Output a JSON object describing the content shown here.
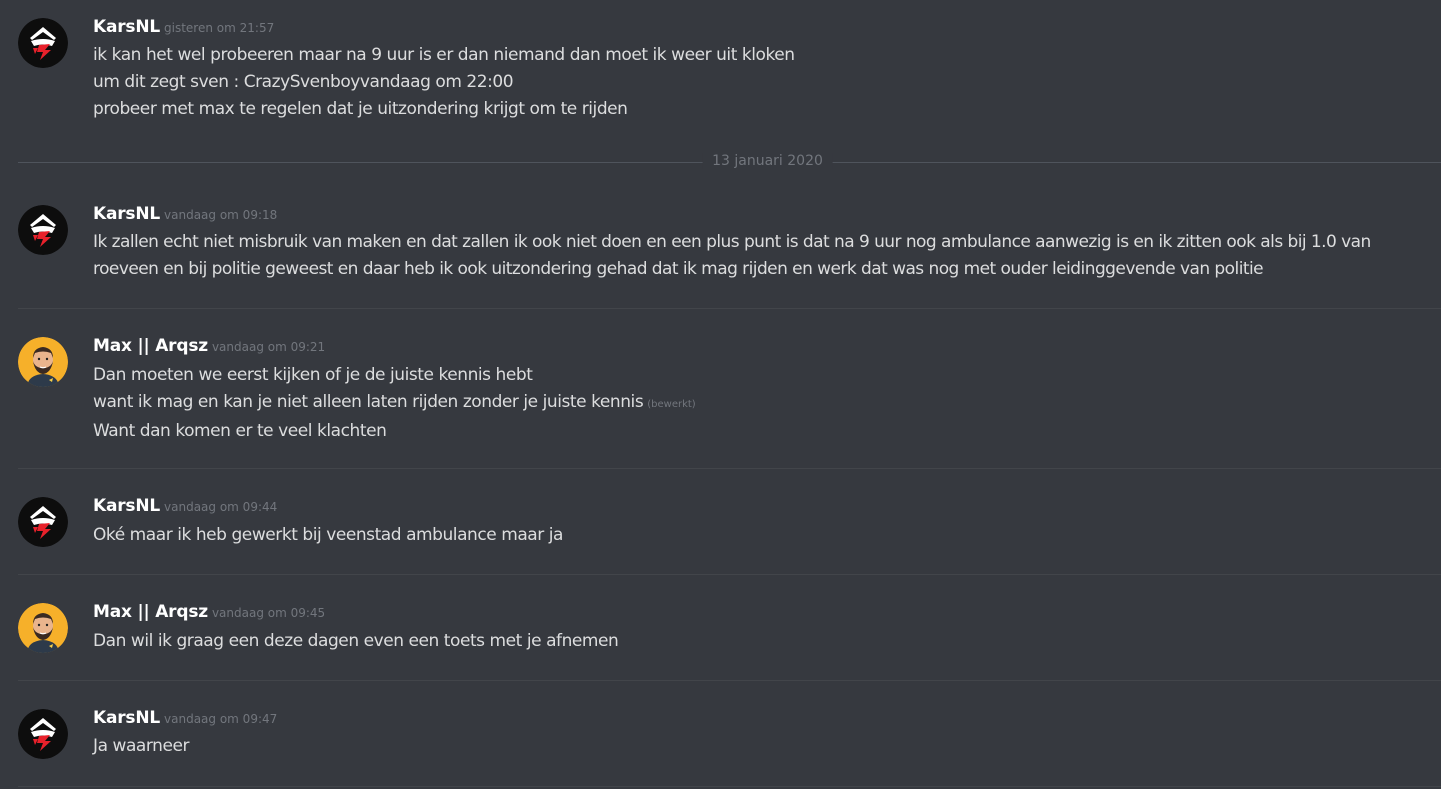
{
  "date_divider": "13 januari 2020",
  "messages": [
    {
      "author": "KarsNL",
      "timestamp": "gisteren om 21:57",
      "avatar_icon": "ninja-logo-icon",
      "lines": [
        "ik kan het wel probeeren maar na 9 uur is er dan niemand dan moet ik weer uit kloken",
        "um dit zegt sven : CrazySvenboyvandaag om 22:00",
        "probeer met max te regelen dat je uitzondering krijgt om te rijden"
      ]
    },
    {
      "author": "KarsNL",
      "timestamp": "vandaag om 09:18",
      "avatar_icon": "ninja-logo-icon",
      "lines": [
        "Ik zallen echt niet misbruik van maken en dat zallen ik ook niet doen en een plus punt is dat na 9 uur nog ambulance aanwezig is  en ik zitten ook als bij 1.0 van roeveen en bij politie geweest en daar heb ik ook uitzondering gehad dat ik mag rijden en werk dat was nog met ouder leidinggevende van politie"
      ]
    },
    {
      "author": "Max || Arqsz",
      "timestamp": "vandaag om 09:21",
      "avatar_icon": "bearded-man-avatar-icon",
      "lines": [
        "Dan moeten we eerst kijken of je de juiste kennis hebt",
        "want ik mag en kan je niet alleen laten rijden zonder je juiste kennis",
        "Want dan komen er te veel klachten"
      ],
      "edited_label": "(bewerkt)"
    },
    {
      "author": "KarsNL",
      "timestamp": "vandaag om 09:44",
      "avatar_icon": "ninja-logo-icon",
      "lines": [
        "Oké maar ik heb gewerkt bij veenstad ambulance maar ja"
      ]
    },
    {
      "author": "Max || Arqsz",
      "timestamp": "vandaag om 09:45",
      "avatar_icon": "bearded-man-avatar-icon",
      "lines": [
        "Dan wil ik graag een deze dagen even een toets met je afnemen"
      ]
    },
    {
      "author": "KarsNL",
      "timestamp": "vandaag om 09:47",
      "avatar_icon": "ninja-logo-icon",
      "lines": [
        "Ja waarneer"
      ]
    }
  ],
  "colors": {
    "background": "#36393f",
    "username": "#ffffff",
    "text": "#dcddde",
    "muted": "#72767d",
    "avatar_max_bg": "#f6b02a"
  }
}
